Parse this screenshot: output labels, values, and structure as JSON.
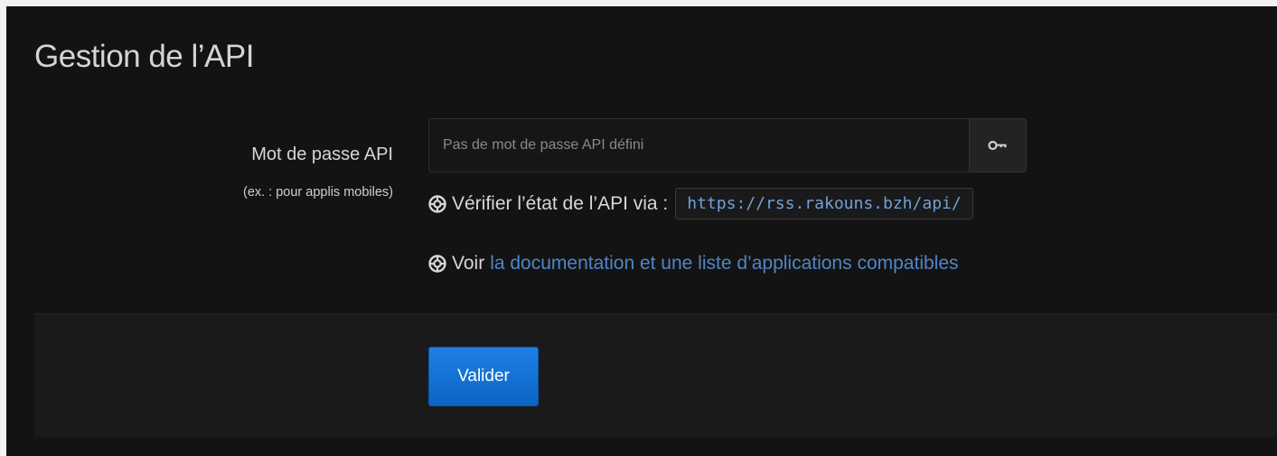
{
  "section": {
    "title": "Gestion de l’API"
  },
  "api_password": {
    "label": "Mot de passe API",
    "hint": "(ex. : pour applis mobiles)",
    "placeholder": "Pas de mot de passe API défini",
    "value": "",
    "toggle_icon": "key-icon"
  },
  "verify": {
    "icon": "support-icon",
    "text": "Vérifier l’état de l’API via :",
    "url": "https://rss.rakouns.bzh/api/"
  },
  "docs": {
    "icon": "support-icon",
    "prefix": "Voir",
    "link_text": "la documentation et une liste d’applications compatibles"
  },
  "actions": {
    "submit_label": "Valider"
  },
  "colors": {
    "background": "#131313",
    "footer": "#1a1a1a",
    "link": "#4f86c6",
    "url_text": "#6fa1d9",
    "primary_button": "#1572d6"
  }
}
